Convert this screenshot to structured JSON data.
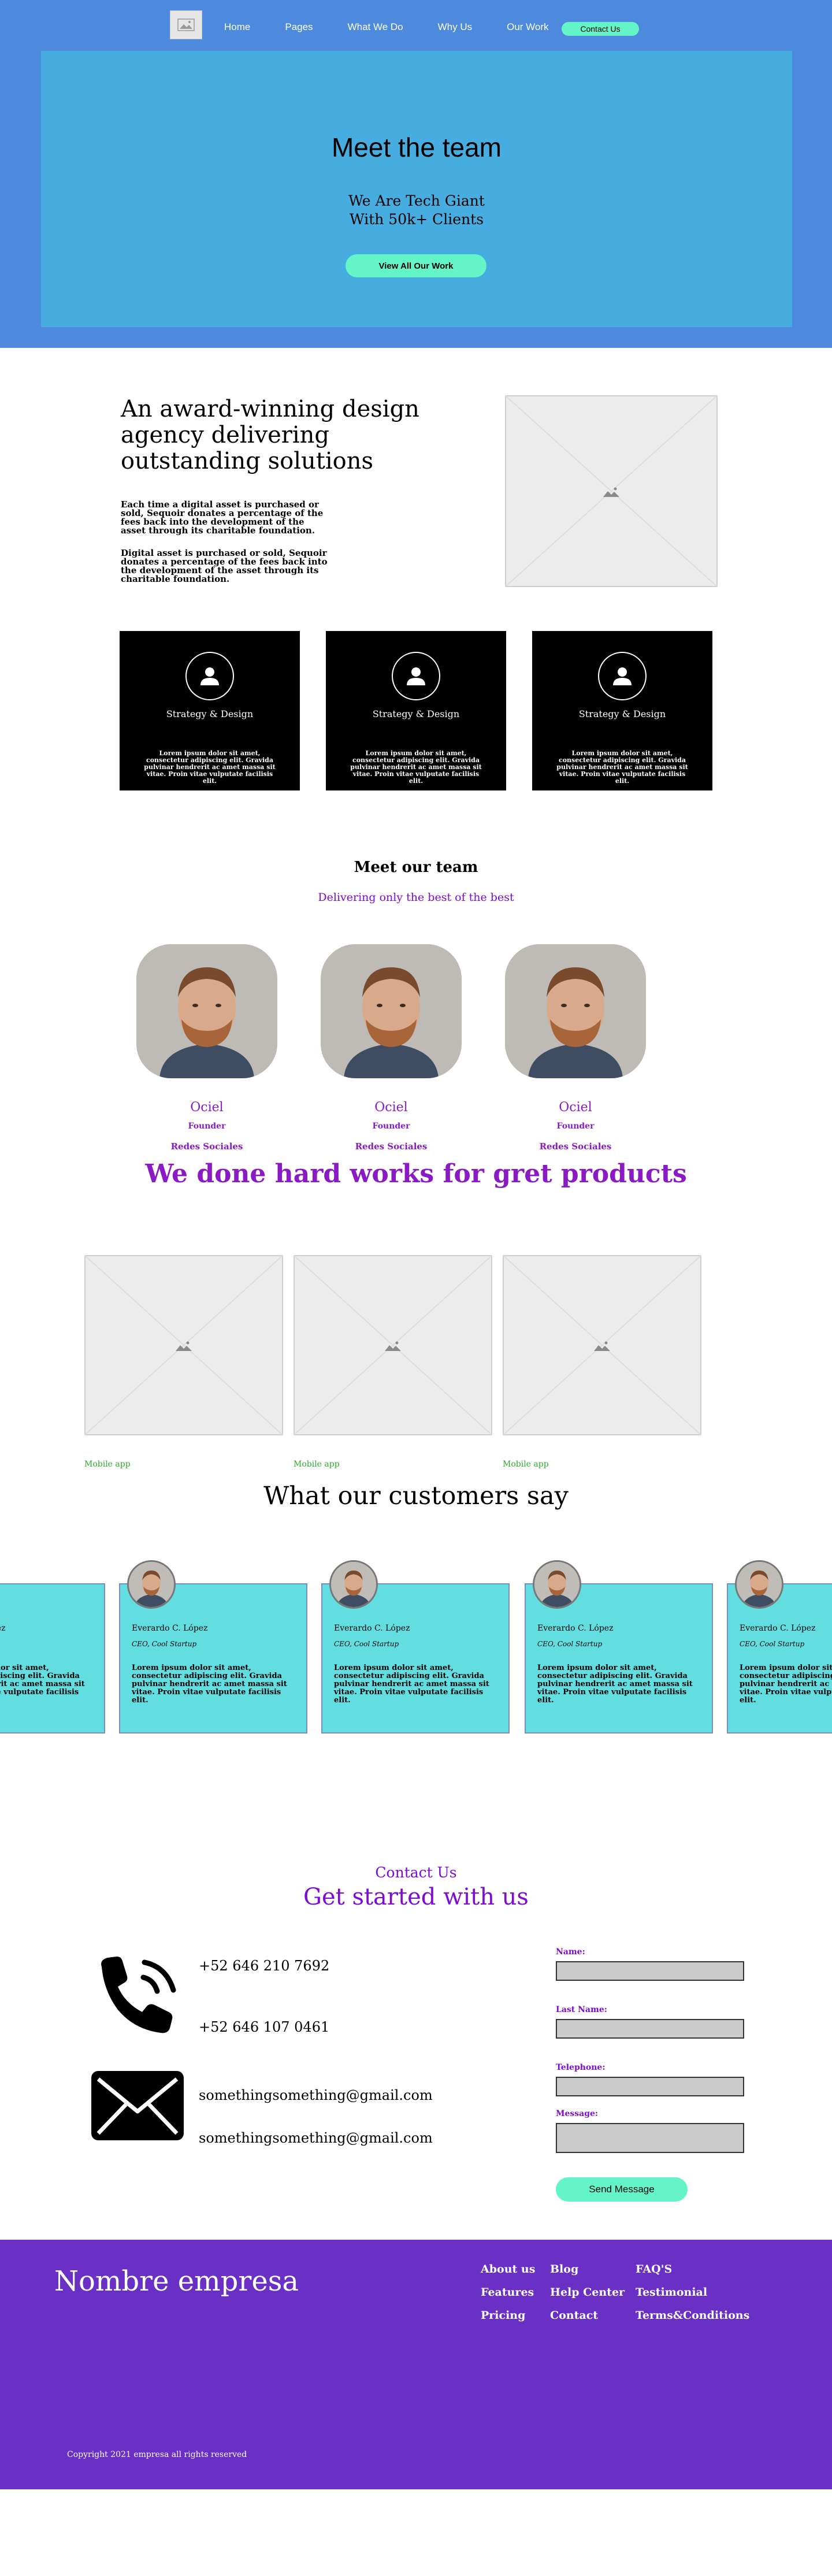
{
  "nav": {
    "links": [
      "Home",
      "Pages",
      "What We Do",
      "Why Us",
      "Our Work"
    ],
    "cta": "Contact Us"
  },
  "hero": {
    "title": "Meet the team",
    "subtitle": "We Are Tech Giant With 50k+ Clients",
    "button": "View All Our Work"
  },
  "about": {
    "heading": "An award-winning design agency delivering outstanding solutions",
    "p1": "Each time a digital asset is purchased or sold, Sequoir donates a percentage of the fees back into the development of the asset through its charitable foundation.",
    "p2": "Digital asset is purchased or sold, Sequoir donates a percentage of the fees back into the development of the asset through its charitable foundation.",
    "cards": [
      {
        "title": "Strategy & Design",
        "text": "Lorem ipsum dolor sit amet, consectetur adipiscing elit. Gravida pulvinar hendrerit ac amet massa sit vitae. Proin vitae vulputate facilisis elit."
      },
      {
        "title": "Strategy & Design",
        "text": "Lorem ipsum dolor sit amet, consectetur adipiscing elit. Gravida pulvinar hendrerit ac amet massa sit vitae. Proin vitae vulputate facilisis elit."
      },
      {
        "title": "Strategy & Design",
        "text": "Lorem ipsum dolor sit amet, consectetur adipiscing elit. Gravida pulvinar hendrerit ac amet massa sit vitae. Proin vitae vulputate facilisis elit."
      }
    ]
  },
  "team": {
    "heading": "Meet our team",
    "subheading": "Delivering only the best of the best",
    "members": [
      {
        "name": "Ociel",
        "role": "Founder",
        "social": "Redes Sociales"
      },
      {
        "name": "Ociel",
        "role": "Founder",
        "social": "Redes Sociales"
      },
      {
        "name": "Ociel",
        "role": "Founder",
        "social": "Redes Sociales"
      }
    ]
  },
  "works": {
    "heading": "We done hard works for gret products",
    "items": [
      {
        "label": "Mobile app"
      },
      {
        "label": "Mobile app"
      },
      {
        "label": "Mobile app"
      }
    ]
  },
  "testimonials": {
    "heading": "What our customers say",
    "items": [
      {
        "name": "Everardo C. López",
        "role": "CEO, Cool Startup",
        "text": "Lorem ipsum dolor sit amet, consectetur adipiscing elit. Gravida pulvinar hendrerit ac amet massa sit vitae. Proin vitae vulputate facilisis elit."
      },
      {
        "name": "Everardo C. López",
        "role": "CEO, Cool Startup",
        "text": "Lorem ipsum dolor sit amet, consectetur adipiscing elit. Gravida pulvinar hendrerit ac amet massa sit vitae. Proin vitae vulputate facilisis elit."
      },
      {
        "name": "Everardo C. López",
        "role": "CEO, Cool Startup",
        "text": "Lorem ipsum dolor sit amet, consectetur adipiscing elit. Gravida pulvinar hendrerit ac amet massa sit vitae. Proin vitae vulputate facilisis elit."
      },
      {
        "name": "Everardo C. López",
        "role": "CEO, Cool Startup",
        "text": "Lorem ipsum dolor sit amet, consectetur adipiscing elit. Gravida pulvinar hendrerit ac amet massa sit vitae. Proin vitae vulputate facilisis elit."
      },
      {
        "name": "Everardo C. López",
        "role": "CEO, Cool Startup",
        "text": "Lorem ipsum dolor sit amet, consectetur adipiscing elit. Gravida pulvinar hendrerit ac amet massa sit vitae. Proin vitae vulputate facilisis elit."
      }
    ]
  },
  "contact": {
    "kicker": "Contact Us",
    "heading": "Get started with us",
    "phone1": "+52 646 210 7692",
    "phone2": "+52 646 107 0461",
    "email1": "somethingsomething@gmail.com",
    "email2": "somethingsomething@gmail.com",
    "form": {
      "name_label": "Name:",
      "last_name_label": "Last Name:",
      "telephone_label": "Telephone:",
      "message_label": "Message:",
      "submit": "Send  Message"
    }
  },
  "footer": {
    "brand": "Nombre empresa",
    "col1": [
      "About us",
      "Features",
      "Pricing"
    ],
    "col2": [
      "Blog",
      "Help Center",
      "Contact"
    ],
    "col3": [
      "FAQ'S",
      "Testimonial",
      "Terms&Conditions"
    ],
    "copyright": "Copyright 2021 empresa all rights reserved"
  },
  "colors": {
    "hero_bg": "#4d8ade",
    "hero_box": "#47ade0",
    "accent_mint": "#63f5c8",
    "purple": "#7d0bd3",
    "testimonial_card": "#62dde0",
    "footer_bg": "#6a2fc4"
  }
}
